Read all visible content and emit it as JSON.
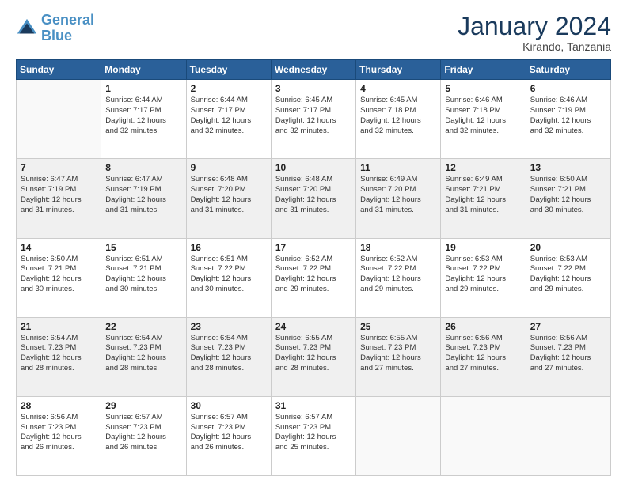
{
  "header": {
    "logo_line1": "General",
    "logo_line2": "Blue",
    "month_title": "January 2024",
    "location": "Kirando, Tanzania"
  },
  "weekdays": [
    "Sunday",
    "Monday",
    "Tuesday",
    "Wednesday",
    "Thursday",
    "Friday",
    "Saturday"
  ],
  "weeks": [
    {
      "shaded": false,
      "days": [
        {
          "date": "",
          "info": ""
        },
        {
          "date": "1",
          "info": "Sunrise: 6:44 AM\nSunset: 7:17 PM\nDaylight: 12 hours\nand 32 minutes."
        },
        {
          "date": "2",
          "info": "Sunrise: 6:44 AM\nSunset: 7:17 PM\nDaylight: 12 hours\nand 32 minutes."
        },
        {
          "date": "3",
          "info": "Sunrise: 6:45 AM\nSunset: 7:17 PM\nDaylight: 12 hours\nand 32 minutes."
        },
        {
          "date": "4",
          "info": "Sunrise: 6:45 AM\nSunset: 7:18 PM\nDaylight: 12 hours\nand 32 minutes."
        },
        {
          "date": "5",
          "info": "Sunrise: 6:46 AM\nSunset: 7:18 PM\nDaylight: 12 hours\nand 32 minutes."
        },
        {
          "date": "6",
          "info": "Sunrise: 6:46 AM\nSunset: 7:19 PM\nDaylight: 12 hours\nand 32 minutes."
        }
      ]
    },
    {
      "shaded": true,
      "days": [
        {
          "date": "7",
          "info": "Sunrise: 6:47 AM\nSunset: 7:19 PM\nDaylight: 12 hours\nand 31 minutes."
        },
        {
          "date": "8",
          "info": "Sunrise: 6:47 AM\nSunset: 7:19 PM\nDaylight: 12 hours\nand 31 minutes."
        },
        {
          "date": "9",
          "info": "Sunrise: 6:48 AM\nSunset: 7:20 PM\nDaylight: 12 hours\nand 31 minutes."
        },
        {
          "date": "10",
          "info": "Sunrise: 6:48 AM\nSunset: 7:20 PM\nDaylight: 12 hours\nand 31 minutes."
        },
        {
          "date": "11",
          "info": "Sunrise: 6:49 AM\nSunset: 7:20 PM\nDaylight: 12 hours\nand 31 minutes."
        },
        {
          "date": "12",
          "info": "Sunrise: 6:49 AM\nSunset: 7:21 PM\nDaylight: 12 hours\nand 31 minutes."
        },
        {
          "date": "13",
          "info": "Sunrise: 6:50 AM\nSunset: 7:21 PM\nDaylight: 12 hours\nand 30 minutes."
        }
      ]
    },
    {
      "shaded": false,
      "days": [
        {
          "date": "14",
          "info": "Sunrise: 6:50 AM\nSunset: 7:21 PM\nDaylight: 12 hours\nand 30 minutes."
        },
        {
          "date": "15",
          "info": "Sunrise: 6:51 AM\nSunset: 7:21 PM\nDaylight: 12 hours\nand 30 minutes."
        },
        {
          "date": "16",
          "info": "Sunrise: 6:51 AM\nSunset: 7:22 PM\nDaylight: 12 hours\nand 30 minutes."
        },
        {
          "date": "17",
          "info": "Sunrise: 6:52 AM\nSunset: 7:22 PM\nDaylight: 12 hours\nand 29 minutes."
        },
        {
          "date": "18",
          "info": "Sunrise: 6:52 AM\nSunset: 7:22 PM\nDaylight: 12 hours\nand 29 minutes."
        },
        {
          "date": "19",
          "info": "Sunrise: 6:53 AM\nSunset: 7:22 PM\nDaylight: 12 hours\nand 29 minutes."
        },
        {
          "date": "20",
          "info": "Sunrise: 6:53 AM\nSunset: 7:22 PM\nDaylight: 12 hours\nand 29 minutes."
        }
      ]
    },
    {
      "shaded": true,
      "days": [
        {
          "date": "21",
          "info": "Sunrise: 6:54 AM\nSunset: 7:23 PM\nDaylight: 12 hours\nand 28 minutes."
        },
        {
          "date": "22",
          "info": "Sunrise: 6:54 AM\nSunset: 7:23 PM\nDaylight: 12 hours\nand 28 minutes."
        },
        {
          "date": "23",
          "info": "Sunrise: 6:54 AM\nSunset: 7:23 PM\nDaylight: 12 hours\nand 28 minutes."
        },
        {
          "date": "24",
          "info": "Sunrise: 6:55 AM\nSunset: 7:23 PM\nDaylight: 12 hours\nand 28 minutes."
        },
        {
          "date": "25",
          "info": "Sunrise: 6:55 AM\nSunset: 7:23 PM\nDaylight: 12 hours\nand 27 minutes."
        },
        {
          "date": "26",
          "info": "Sunrise: 6:56 AM\nSunset: 7:23 PM\nDaylight: 12 hours\nand 27 minutes."
        },
        {
          "date": "27",
          "info": "Sunrise: 6:56 AM\nSunset: 7:23 PM\nDaylight: 12 hours\nand 27 minutes."
        }
      ]
    },
    {
      "shaded": false,
      "days": [
        {
          "date": "28",
          "info": "Sunrise: 6:56 AM\nSunset: 7:23 PM\nDaylight: 12 hours\nand 26 minutes."
        },
        {
          "date": "29",
          "info": "Sunrise: 6:57 AM\nSunset: 7:23 PM\nDaylight: 12 hours\nand 26 minutes."
        },
        {
          "date": "30",
          "info": "Sunrise: 6:57 AM\nSunset: 7:23 PM\nDaylight: 12 hours\nand 26 minutes."
        },
        {
          "date": "31",
          "info": "Sunrise: 6:57 AM\nSunset: 7:23 PM\nDaylight: 12 hours\nand 25 minutes."
        },
        {
          "date": "",
          "info": ""
        },
        {
          "date": "",
          "info": ""
        },
        {
          "date": "",
          "info": ""
        }
      ]
    }
  ]
}
